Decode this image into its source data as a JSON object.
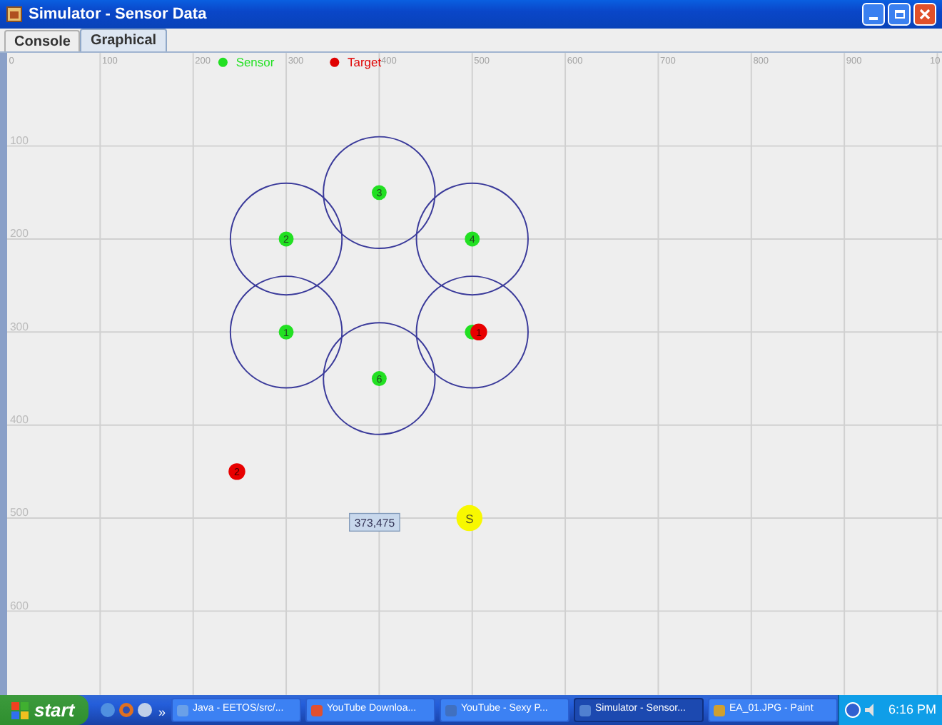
{
  "window": {
    "title": "Simulator - Sensor Data"
  },
  "tabs": [
    {
      "label": "Console",
      "selected": false
    },
    {
      "label": "Graphical",
      "selected": true
    }
  ],
  "legend": [
    {
      "label": "Sensor",
      "color": "#22e022"
    },
    {
      "label": "Target",
      "color": "#e00000"
    }
  ],
  "x_axis_labels": [
    "0",
    "100",
    "200",
    "300",
    "400",
    "500",
    "600",
    "700",
    "800",
    "900",
    "10"
  ],
  "y_axis_labels": [
    "100",
    "200",
    "300",
    "400",
    "500",
    "600"
  ],
  "sensors": [
    {
      "label": "1",
      "covered": false
    },
    {
      "label": "2",
      "covered": false
    },
    {
      "label": "3",
      "covered": false
    },
    {
      "label": "4",
      "covered": false
    },
    {
      "covered": true
    },
    {
      "label": "6",
      "covered": false
    }
  ],
  "targets": [
    {
      "label": "1"
    },
    {
      "label": "2"
    }
  ],
  "sink": {
    "label": "S"
  },
  "cursor_readout": "373,475",
  "taskbar": {
    "start": "start",
    "more": "»",
    "tasks": [
      {
        "label": "Java - EETOS/src/...",
        "selected": false
      },
      {
        "label": "YouTube Downloa...",
        "selected": false
      },
      {
        "label": "YouTube - Sexy P...",
        "selected": false
      },
      {
        "label": "Simulator - Sensor...",
        "selected": true
      },
      {
        "label": "EA_01.JPG - Paint",
        "selected": false
      }
    ],
    "clock": "6:16 PM"
  }
}
